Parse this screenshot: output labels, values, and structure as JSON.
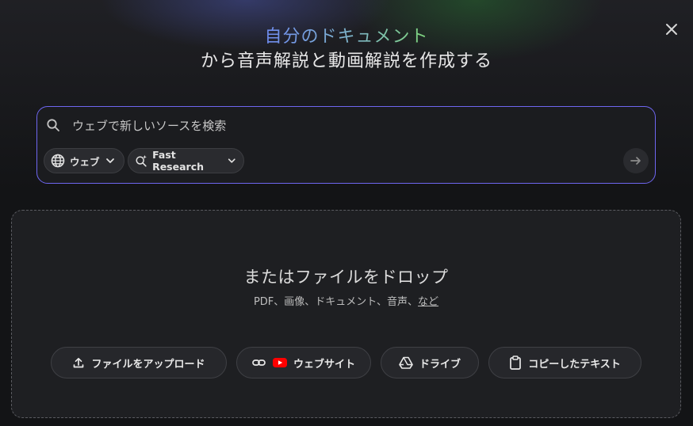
{
  "header": {
    "title_line1": "自分のドキュメント",
    "title_line2": "から音声解説と動画解説を作成する",
    "close_icon": "close-icon"
  },
  "search": {
    "placeholder": "ウェブで新しいソースを検索",
    "value": "",
    "source_chip_label": "ウェブ",
    "mode_chip_label": "Fast Research",
    "icons": [
      "search-icon",
      "globe-icon",
      "sparkle-search-icon",
      "chevron-down-icon",
      "arrow-right-icon"
    ]
  },
  "drop_zone": {
    "title": "またはファイルをドロップ",
    "subtitle": "PDF、画像、ドキュメント、音声、",
    "more_link": "など",
    "buttons": [
      {
        "label": "ファイルをアップロード",
        "icon": "upload-icon"
      },
      {
        "label": "ウェブサイト",
        "icon": "link-youtube-icon"
      },
      {
        "label": "ドライブ",
        "icon": "drive-icon"
      },
      {
        "label": "コピーしたテキスト",
        "icon": "clipboard-icon"
      }
    ]
  },
  "colors": {
    "background": "#131416",
    "search_border": "#6e66f0",
    "gradient_start": "#6f8cf2",
    "gradient_end": "#7ed67a",
    "youtube_red": "#ff0000"
  }
}
